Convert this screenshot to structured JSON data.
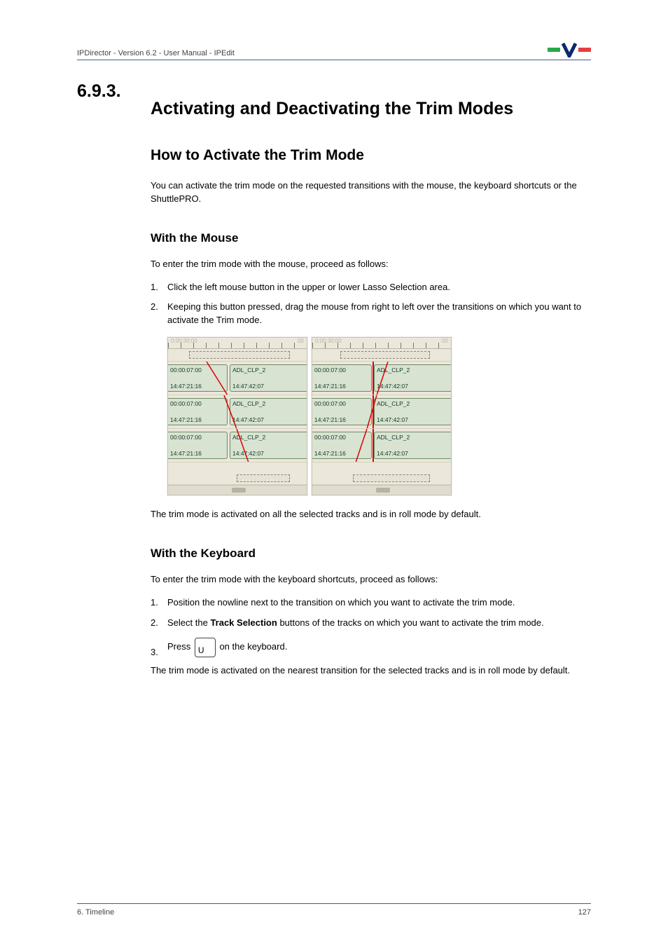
{
  "header": {
    "breadcrumb": "IPDirector - Version 6.2 - User Manual - IPEdit"
  },
  "section": {
    "number": "6.9.3.",
    "title": "Activating and Deactivating the Trim Modes"
  },
  "h2_how_to": "How to Activate the Trim Mode",
  "intro_para": "You can activate the trim mode on the requested transitions with the mouse, the keyboard shortcuts or the ShuttlePRO.",
  "mouse": {
    "heading": "With the Mouse",
    "intro": "To enter the trim mode with the mouse, proceed as follows:",
    "steps": [
      "Click the left mouse button in the upper or lower Lasso Selection area.",
      "Keeping this button pressed, drag the mouse from right to left over the transitions on which you want to activate the Trim mode."
    ],
    "after": "The trim mode is activated on all the selected tracks and is in roll mode by default."
  },
  "keyboard": {
    "heading": "With the Keyboard",
    "intro": "To enter the trim mode with the keyboard shortcuts, proceed as follows:",
    "step1": "Position the nowline next to the transition on which you want to activate the trim mode.",
    "step2_pre": "Select the ",
    "step2_bold": "Track Selection",
    "step2_post": " buttons of the tracks on which you want to activate the trim mode.",
    "step3_pre": "Press ",
    "step3_key": "U",
    "step3_post": " on the keyboard.",
    "after": "The trim mode is activated on the nearest transition for the selected tracks and is in roll mode by default."
  },
  "figure": {
    "ruler_left": "0:00:30:00",
    "ruler_right": "00",
    "clip_top_tc": "00:00:07:00",
    "clip_top_name": "ADL_CLP_2",
    "clip_bot_left": "14:47:21:16",
    "clip_bot_right": "14:47:42:07"
  },
  "footer": {
    "left": "6. Timeline",
    "right": "127"
  }
}
